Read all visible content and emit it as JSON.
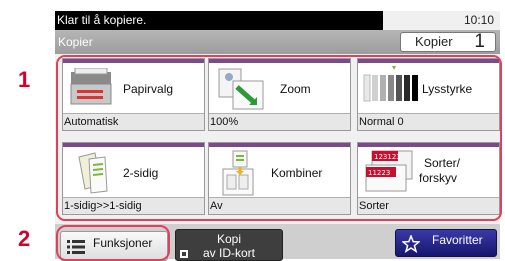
{
  "callouts": {
    "one": "1",
    "two": "2"
  },
  "status": {
    "message": "Klar til å kopiere.",
    "time": "10:10"
  },
  "title": {
    "text": "Kopier",
    "copies_label": "Kopier",
    "copies_count": "1"
  },
  "functions": {
    "paper": {
      "label": "Papirvalg",
      "value": "Automatisk",
      "icon": "paper-tray-icon"
    },
    "zoom": {
      "label": "Zoom",
      "value": "100%",
      "icon": "zoom-icon"
    },
    "density": {
      "label": "Lysstyrke",
      "value": "Normal 0",
      "icon": "density-icon"
    },
    "duplex": {
      "label": "2-sidig",
      "value": "1-sidig>>1-sidig",
      "icon": "duplex-icon"
    },
    "combine": {
      "label": "Kombiner",
      "value": "Av",
      "icon": "combine-icon"
    },
    "collate": {
      "label1": "Sorter/",
      "label2": "forskyv",
      "value": "Sorter",
      "icon": "collate-icon",
      "icon_text1": "123123",
      "icon_text2": "11223"
    }
  },
  "bottom": {
    "functions_label": "Funksjoner",
    "idcard_line1": "Kopi",
    "idcard_line2": "av ID-kort",
    "favorites_label": "Favoritter"
  },
  "colors": {
    "accent": "#7a4a8b",
    "highlight": "#e0405a",
    "favorites": "#16166e"
  }
}
